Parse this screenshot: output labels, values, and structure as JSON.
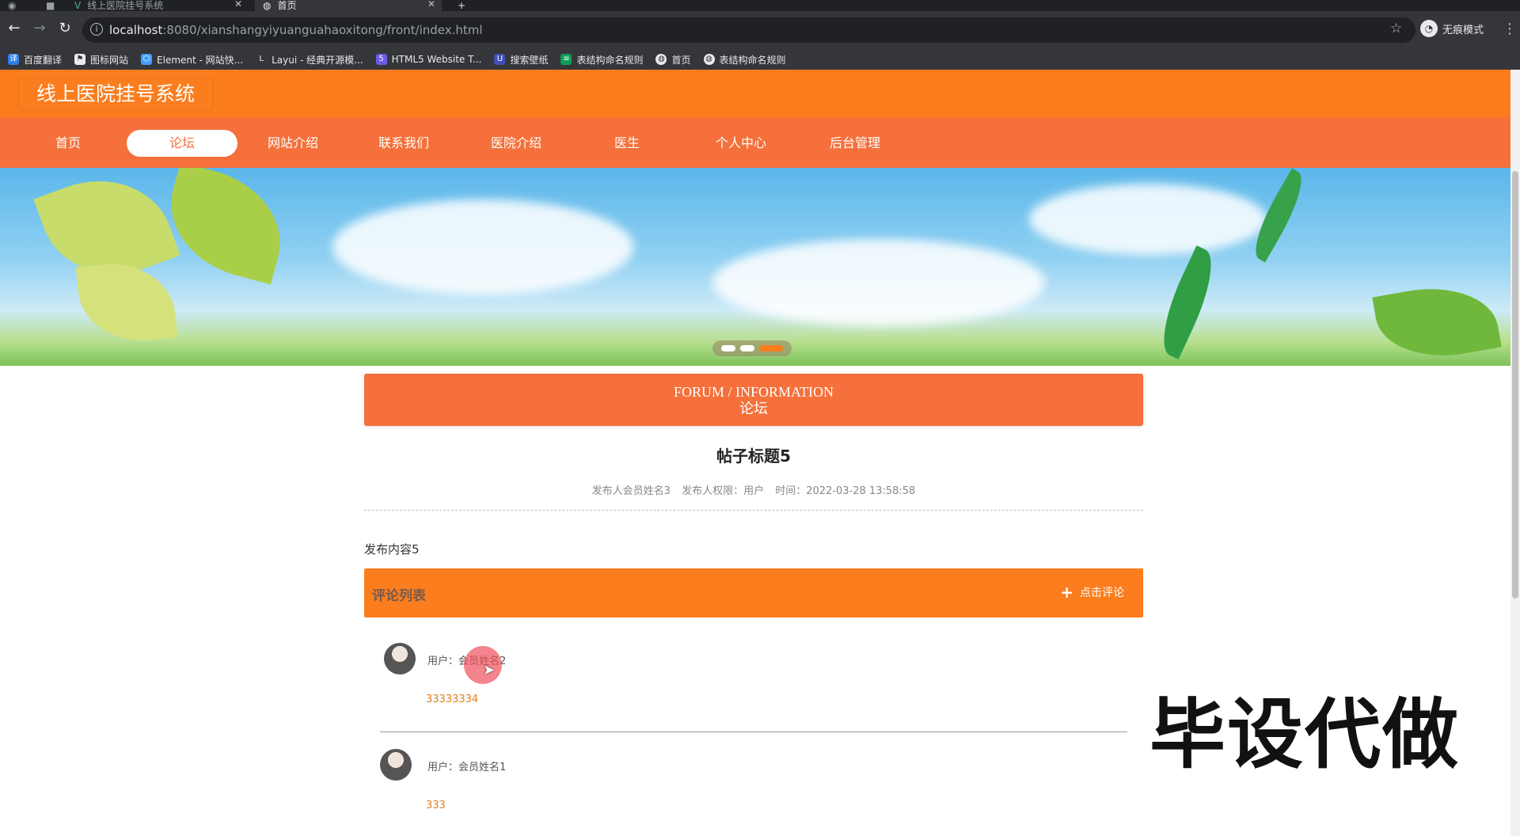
{
  "browser": {
    "tabs": [
      {
        "title": "线上医院挂号系统",
        "active": false
      },
      {
        "title": "首页",
        "active": true
      }
    ],
    "new_tab": "+",
    "url_host": "localhost",
    "url_path": ":8080/xianshangyiyuanguahaoxitong/front/index.html",
    "incognito_label": "无痕模式",
    "bookmarks": [
      {
        "label": "百度翻译",
        "icon": "translate-icon",
        "color": "#2b7de9"
      },
      {
        "label": "图标网站",
        "icon": "flag-icon",
        "color": "#555555"
      },
      {
        "label": "Element - 网站快...",
        "icon": "element-icon",
        "color": "#409eff"
      },
      {
        "label": "Layui - 经典开源模...",
        "icon": "layui-icon",
        "color": "#333333"
      },
      {
        "label": "HTML5 Website T...",
        "icon": "html5-icon",
        "color": "#6c5ce7"
      },
      {
        "label": "搜索壁纸",
        "icon": "wallpaper-icon",
        "color": "#3f51b5"
      },
      {
        "label": "表结构命名规则",
        "icon": "sheet-icon",
        "color": "#0f9d58"
      },
      {
        "label": "首页",
        "icon": "globe-icon",
        "color": "#777777"
      },
      {
        "label": "表结构命名规则",
        "icon": "globe-icon",
        "color": "#777777"
      }
    ]
  },
  "site": {
    "title": "线上医院挂号系统",
    "nav": [
      "首页",
      "论坛",
      "网站介绍",
      "联系我们",
      "医院介绍",
      "医生",
      "个人中心",
      "后台管理"
    ],
    "active_nav": 1,
    "accent": "#fb7d1e",
    "nav_color": "#f5703a"
  },
  "carousel": {
    "slides": 3,
    "active": 3
  },
  "forum": {
    "heading_en": "FORUM / INFORMATION",
    "heading_cn": "论坛"
  },
  "post": {
    "title": "帖子标题5",
    "author": "发布人会员姓名3",
    "role": "发布人权限：用户",
    "time": "时间：2022-03-28 13:58:58",
    "content": "发布内容5"
  },
  "comments": {
    "title": "评论列表",
    "add_label": "点击评论",
    "items": [
      {
        "user": "用户：会员姓名2",
        "text": "33333334"
      },
      {
        "user": "用户：会员姓名1",
        "text": "333"
      }
    ]
  },
  "watermark": "毕设代做"
}
